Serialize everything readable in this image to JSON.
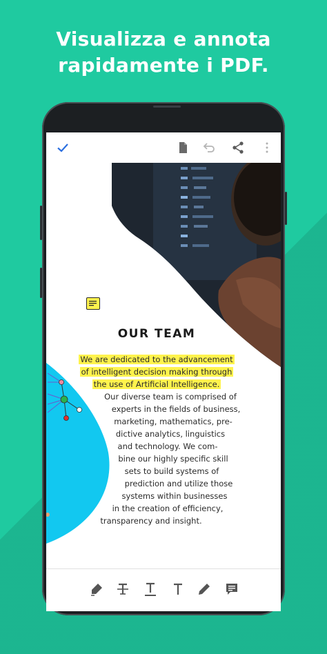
{
  "headline": {
    "line1": "Visualizza e annota",
    "line2": "rapidamente i PDF."
  },
  "colors": {
    "background": "#1fcaa0",
    "accent": "#2b6fe0",
    "highlight": "#fff34d",
    "shape_cyan": "#12c8f0"
  },
  "toolbar": {
    "left_icon": "check-icon",
    "right_icons": [
      "document-icon",
      "undo-icon",
      "share-icon",
      "more-icon"
    ]
  },
  "document": {
    "title": "OUR TEAM",
    "highlighted_lines": [
      "We are dedicated to the advancement",
      "of intelligent decision making through",
      "the use of Artificial Intelligence."
    ],
    "body_lines": [
      "Our diverse team is comprised of",
      "experts in the fields of business,",
      "marketing, mathematics, pre-",
      "dictive analytics, linguistics",
      "and technology.  We com-",
      "bine our highly specific skill",
      "sets to build systems of",
      "prediction and utilize those",
      "systems within businesses",
      "in the creation of efficiency,",
      "transparency and insight."
    ]
  },
  "bottom_tools": [
    "highlighter-icon",
    "strikethrough-icon",
    "underline-icon",
    "text-icon",
    "pen-icon",
    "comment-icon"
  ]
}
